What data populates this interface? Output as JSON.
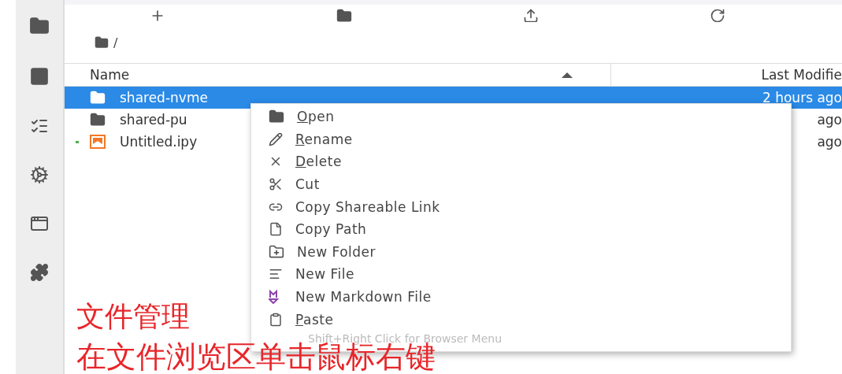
{
  "breadcrumb": "/",
  "columns": [
    {
      "label": "Name",
      "sorted": true
    },
    {
      "label": "Last Modifie"
    }
  ],
  "files": [
    {
      "name": "shared-nvme",
      "kind": "folder",
      "selected": true,
      "running": false,
      "modified": "2 hours ago"
    },
    {
      "name": "shared-pu",
      "kind": "folder",
      "selected": false,
      "running": false,
      "modified": "ago"
    },
    {
      "name": "Untitled.ipy",
      "kind": "notebook",
      "selected": false,
      "running": true,
      "modified": "ago"
    }
  ],
  "context_menu": {
    "items": [
      {
        "label": "Open",
        "underlined": true
      },
      {
        "label": "Rename",
        "underlined": true
      },
      {
        "label": "Delete",
        "underlined": true
      },
      {
        "label": "Cut",
        "underlined": false
      },
      {
        "label": "Copy Shareable Link",
        "underlined": false
      },
      {
        "label": "Copy Path",
        "underlined": false
      },
      {
        "label": "New Folder",
        "underlined": false
      },
      {
        "label": "New File",
        "underlined": false
      },
      {
        "label": "New Markdown File",
        "underlined": false
      },
      {
        "label": "Paste",
        "underlined": true
      }
    ],
    "hint": "Shift+Right Click for Browser Menu"
  },
  "annotations": [
    "文件管理",
    "在文件浏览区单击鼠标右键"
  ]
}
